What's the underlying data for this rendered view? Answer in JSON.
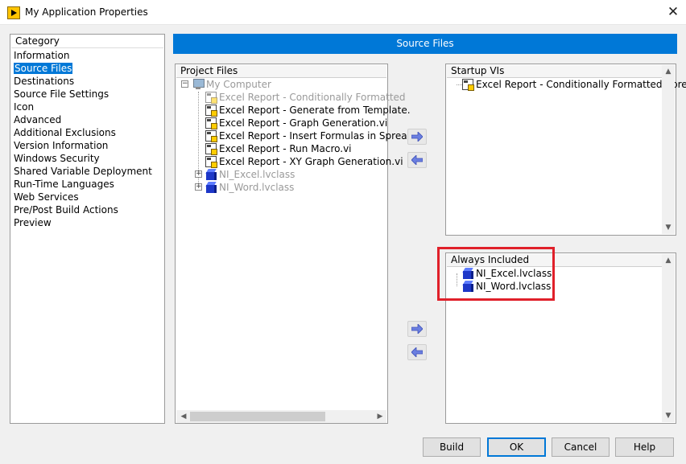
{
  "window": {
    "title": "My Application Properties",
    "close_icon": "close-icon",
    "app_icon": "labview-app-icon"
  },
  "category": {
    "header": "Category",
    "items": [
      {
        "label": "Information",
        "selected": false
      },
      {
        "label": "Source Files",
        "selected": true
      },
      {
        "label": "Destinations",
        "selected": false
      },
      {
        "label": "Source File Settings",
        "selected": false
      },
      {
        "label": "Icon",
        "selected": false
      },
      {
        "label": "Advanced",
        "selected": false
      },
      {
        "label": "Additional Exclusions",
        "selected": false
      },
      {
        "label": "Version Information",
        "selected": false
      },
      {
        "label": "Windows Security",
        "selected": false
      },
      {
        "label": "Shared Variable Deployment",
        "selected": false
      },
      {
        "label": "Run-Time Languages",
        "selected": false
      },
      {
        "label": "Web Services",
        "selected": false
      },
      {
        "label": "Pre/Post Build Actions",
        "selected": false
      },
      {
        "label": "Preview",
        "selected": false
      }
    ]
  },
  "page_banner": "Source Files",
  "project_files": {
    "header": "Project Files",
    "root": {
      "label": "My Computer",
      "icon": "computer-icon",
      "dimmed": true
    },
    "items": [
      {
        "label": "Excel Report - Conditionally Formatted",
        "icon": "vi-icon",
        "dimmed": true
      },
      {
        "label": "Excel Report - Generate from Template.",
        "icon": "vi-icon",
        "dimmed": false
      },
      {
        "label": "Excel Report - Graph Generation.vi",
        "icon": "vi-icon",
        "dimmed": false
      },
      {
        "label": "Excel Report - Insert Formulas in Spreac",
        "icon": "vi-icon",
        "dimmed": false
      },
      {
        "label": "Excel Report - Run Macro.vi",
        "icon": "vi-icon",
        "dimmed": false
      },
      {
        "label": "Excel Report - XY Graph Generation.vi",
        "icon": "vi-icon",
        "dimmed": false
      },
      {
        "label": "NI_Excel.lvclass",
        "icon": "lvclass-icon",
        "dimmed": true,
        "expandable": true
      },
      {
        "label": "NI_Word.lvclass",
        "icon": "lvclass-icon",
        "dimmed": true,
        "expandable": true
      }
    ]
  },
  "startup_vis": {
    "header": "Startup VIs",
    "items": [
      {
        "label": "Excel Report - Conditionally Formatted Spre",
        "icon": "vi-icon"
      }
    ]
  },
  "always_included": {
    "header": "Always Included",
    "items": [
      {
        "label": "NI_Excel.lvclass",
        "icon": "lvclass-icon"
      },
      {
        "label": "NI_Word.lvclass",
        "icon": "lvclass-icon"
      }
    ]
  },
  "buttons": {
    "build": "Build",
    "ok": "OK",
    "cancel": "Cancel",
    "help": "Help"
  },
  "colors": {
    "accent": "#0078d7",
    "highlight_box": "#e0202a"
  }
}
